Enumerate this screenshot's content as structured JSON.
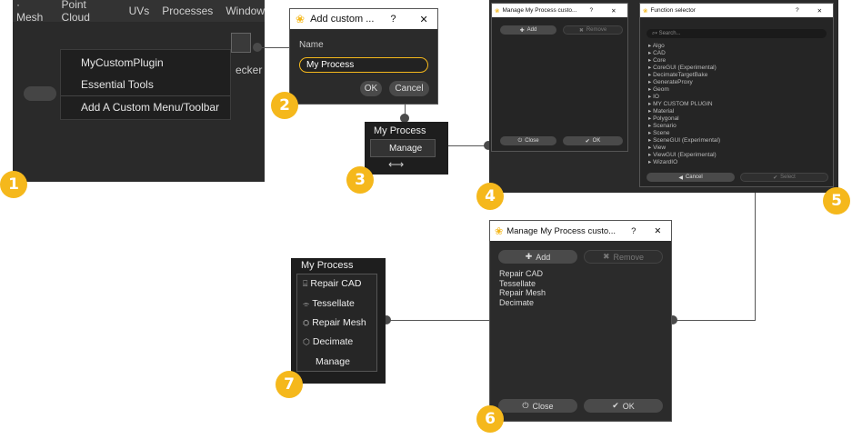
{
  "panel1": {
    "menubar": [
      "· Mesh",
      "Point Cloud",
      "UVs",
      "Processes",
      "Window"
    ],
    "dropdown": [
      "MyCustomPlugin",
      "Essential Tools",
      "Add A Custom Menu/Toolbar"
    ],
    "side_text": "ecker"
  },
  "panel2": {
    "title": "Add custom ...",
    "help": "?",
    "close": "✕",
    "name_label": "Name",
    "name_value": "My Process",
    "ok": "OK",
    "cancel": "Cancel"
  },
  "panel3": {
    "menu_title": "My Process",
    "item": "Manage"
  },
  "panel4": {
    "title": "Manage My Process custo...",
    "help": "?",
    "close": "✕",
    "add": "Add",
    "remove": "Remove",
    "close_btn": "Close",
    "ok": "OK"
  },
  "panel5": {
    "title": "Function selector",
    "help": "?",
    "close": "✕",
    "search_placeholder": "Search...",
    "items": [
      "Algo",
      "CAD",
      "Core",
      "CoreGUI (Experimental)",
      "DecimateTargetBake",
      "GenerateProxy",
      "Geom",
      "IO",
      "MY CUSTOM PLUGIN",
      "Material",
      "Polygonal",
      "Scenario",
      "Scene",
      "SceneGUI (Experimental)",
      "View",
      "ViewGUI (Experimental)",
      "WizardIO"
    ],
    "cancel": "Cancel",
    "select": "Select"
  },
  "panel6": {
    "title": "Manage My Process custo...",
    "help": "?",
    "close": "✕",
    "add": "Add",
    "remove": "Remove",
    "items": [
      "Repair CAD",
      "Tessellate",
      "Repair Mesh",
      "Decimate"
    ],
    "close_btn": "Close",
    "ok": "OK"
  },
  "panel7": {
    "menu_title": "My Process",
    "items": [
      "Repair CAD",
      "Tessellate",
      "Repair Mesh",
      "Decimate"
    ],
    "manage": "Manage"
  },
  "steps": [
    "1",
    "2",
    "3",
    "4",
    "5",
    "6",
    "7"
  ],
  "colors": {
    "accent": "#f5b81c",
    "dialog_bg": "#2b2b2b",
    "button": "#4a4a4a"
  }
}
